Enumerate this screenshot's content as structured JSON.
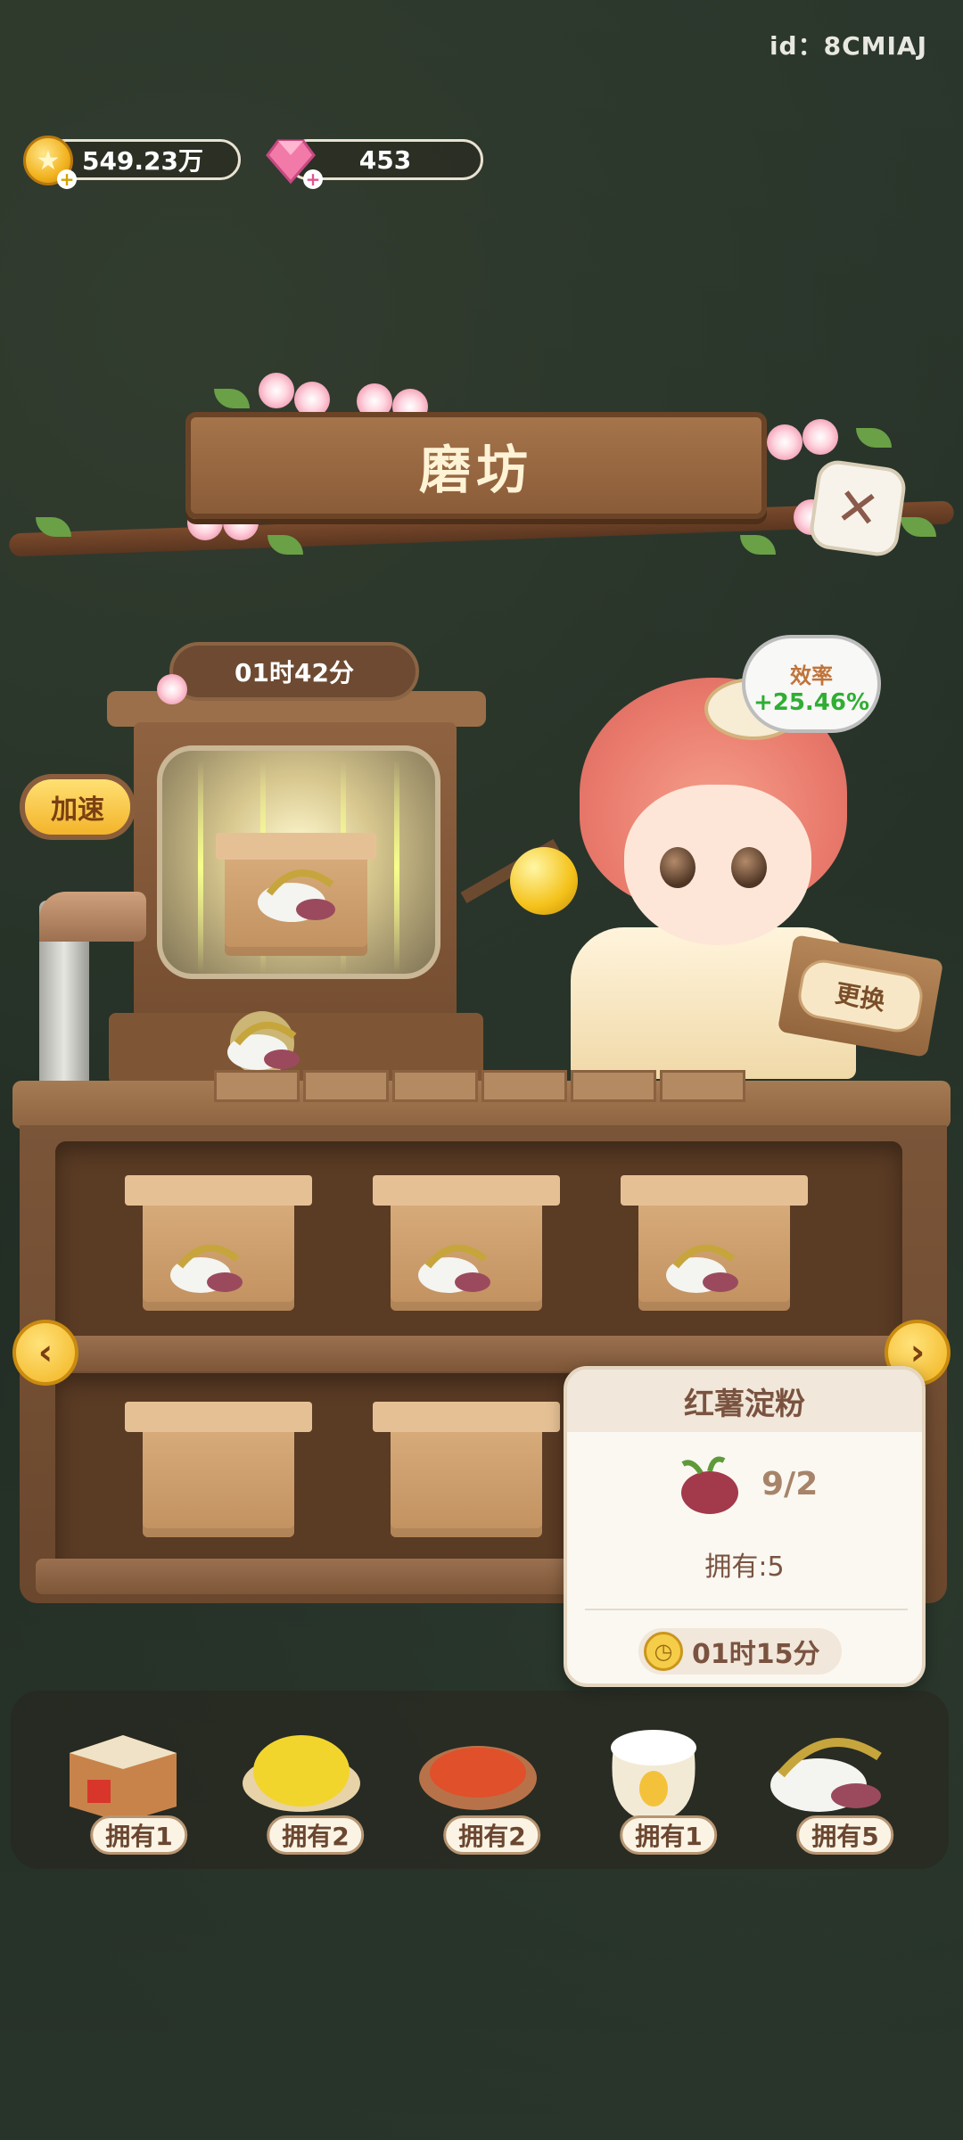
{
  "header": {
    "user_id": "id：8CMIAJ",
    "coins": "549.23万",
    "gems": "453"
  },
  "mill": {
    "title": "磨坊",
    "production_timer": "01时42分",
    "speed_up_label": "加速",
    "efficiency_label": "效率",
    "efficiency_value": "+25.46%",
    "change_label": "更换"
  },
  "tooltip": {
    "item_name": "红薯淀粉",
    "requirement": "9/2",
    "owned": "拥有:5",
    "time": "01时15分"
  },
  "inventory": [
    {
      "icon": "rice-crate-icon",
      "label": "拥有1"
    },
    {
      "icon": "corn-meal-icon",
      "label": "拥有2"
    },
    {
      "icon": "chili-powder-icon",
      "label": "拥有2"
    },
    {
      "icon": "flour-sack-icon",
      "label": "拥有1"
    },
    {
      "icon": "sweet-potato-starch-icon",
      "label": "拥有5"
    }
  ],
  "colors": {
    "accent": "#f3b42a",
    "efficiency": "#2fae33",
    "wood": "#8a5c38"
  }
}
